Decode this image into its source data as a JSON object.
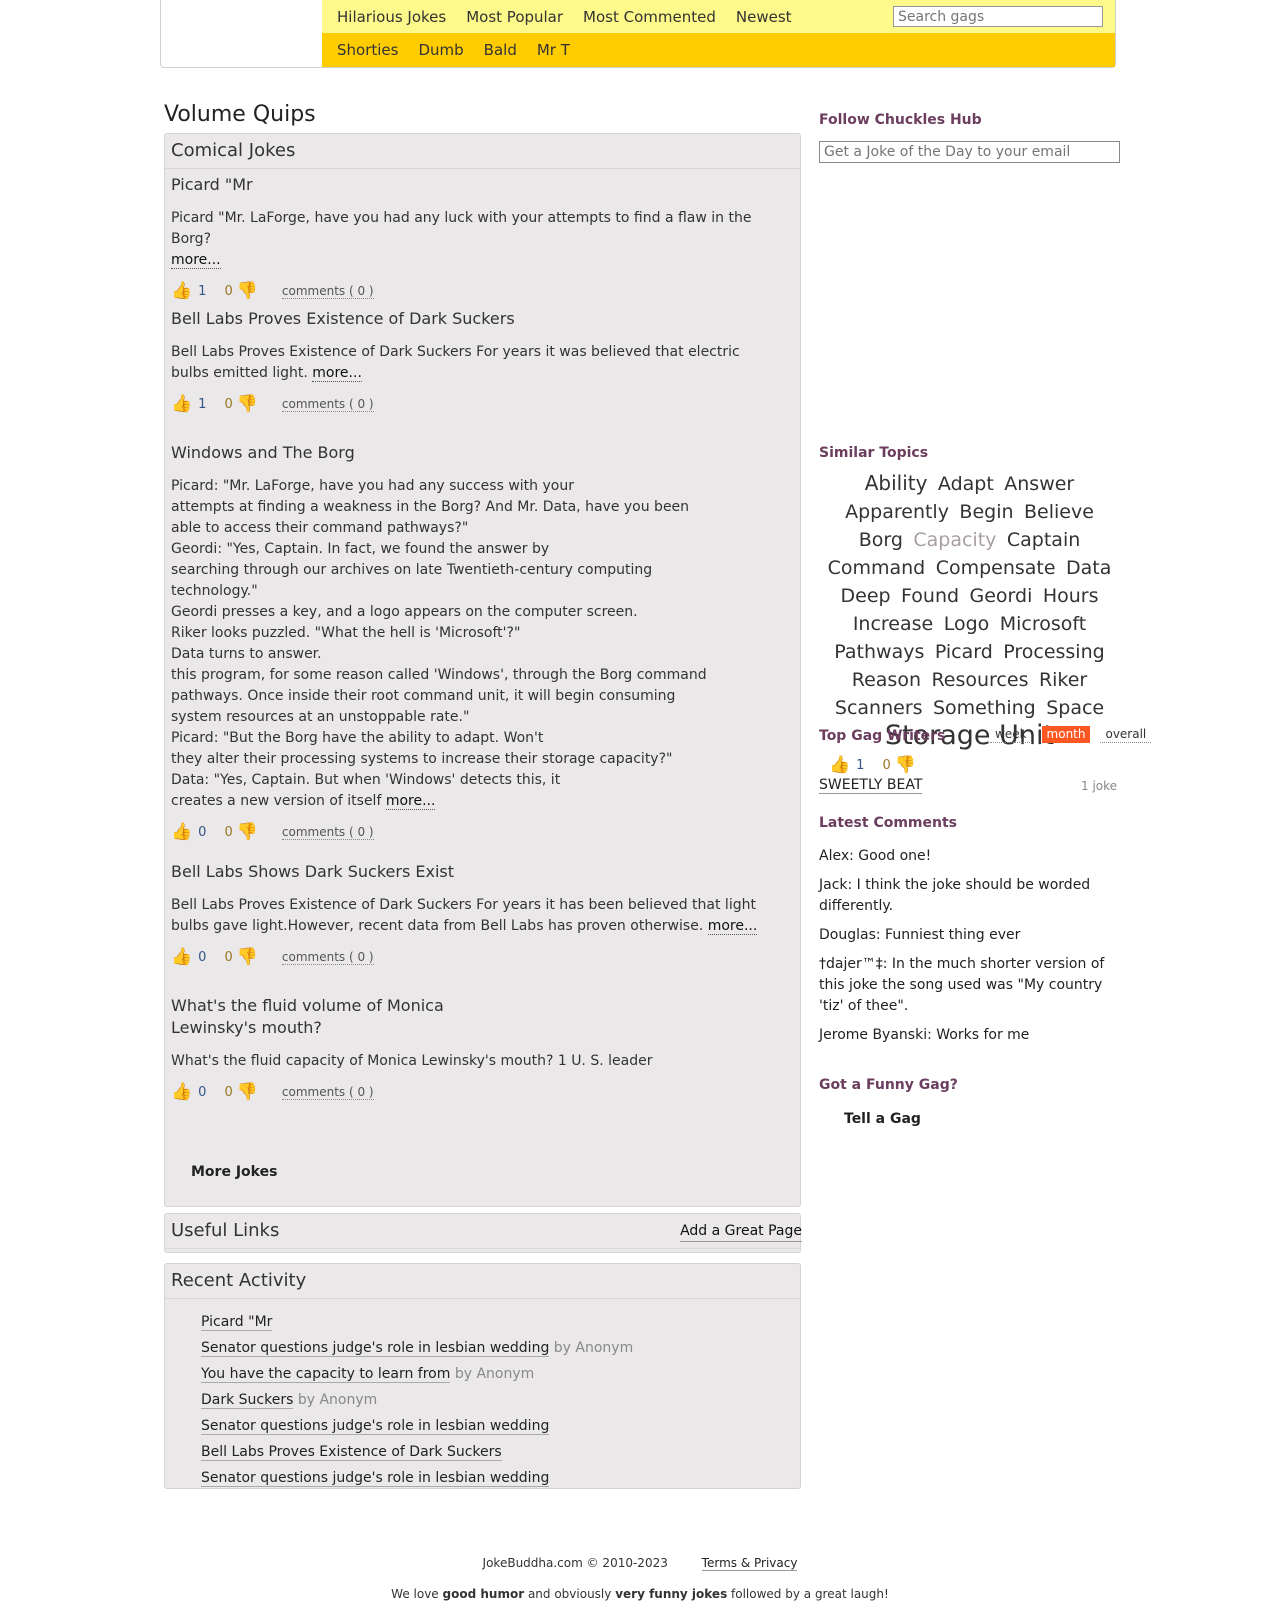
{
  "nav": {
    "top": [
      "Hilarious Jokes",
      "Most Popular",
      "Most Commented",
      "Newest"
    ],
    "bottom": [
      "Shorties",
      "Dumb",
      "Bald",
      "Mr T"
    ],
    "search_placeholder": "Search gags"
  },
  "page_title": "Volume Quips",
  "jokes_section": {
    "heading": "Comical Jokes",
    "more_label": "more...",
    "comments_label": "comments ( 0 )",
    "jokes": [
      {
        "title": "Picard \"Mr",
        "body": "Picard \"Mr. LaForge, have you had any luck with your attempts to find a flaw in the Borg?",
        "up": "1",
        "down": "0"
      },
      {
        "title": "Bell Labs Proves Existence of Dark Suckers",
        "body": "Bell Labs Proves Existence of Dark Suckers For years it was believed that electric bulbs emitted light.",
        "up": "1",
        "down": "0"
      },
      {
        "title": "Windows and The Borg",
        "body": "Picard: \"Mr. LaForge, have you had any success with your\nattempts at finding a weakness in the Borg? And Mr. Data, have you been\nable to access their command pathways?\"\nGeordi: \"Yes, Captain. In fact, we found the answer by\nsearching through our archives on late Twentieth-century computing\ntechnology.\"\nGeordi presses a key, and a logo appears on the computer screen.\nRiker looks puzzled. \"What the hell is 'Microsoft'?\"\nData turns to answer.\nthis program, for some reason called 'Windows', through the Borg command\npathways. Once inside their root command unit, it will begin consuming\nsystem resources at an unstoppable rate.\"\nPicard: \"But the Borg have the ability to adapt. Won't\nthey alter their processing systems to increase their storage capacity?\"\nData: \"Yes, Captain. But when 'Windows' detects this, it\ncreates a new version of itself",
        "up": "0",
        "down": "0"
      },
      {
        "title": "Bell Labs Shows Dark Suckers Exist",
        "body": "Bell Labs Proves Existence of Dark Suckers For years it has been believed that light bulbs gave light.However, recent data from Bell Labs has proven otherwise.",
        "up": "0",
        "down": "0"
      },
      {
        "title": "What's the fluid volume of Monica Lewinsky's mouth?",
        "body": "What's the fluid capacity of Monica Lewinsky's mouth? 1 U. S. leader",
        "up": "0",
        "down": "0"
      }
    ],
    "more_jokes": "More Jokes"
  },
  "useful_links": {
    "heading": "Useful Links",
    "add_label": "Add a Great Page"
  },
  "recent_activity": {
    "heading": "Recent Activity",
    "items": [
      {
        "title": "Picard \"Mr",
        "by": ""
      },
      {
        "title": "Senator questions judge's role in lesbian wedding",
        "by": "by Anonym"
      },
      {
        "title": "You have the capacity to learn from",
        "by": "by Anonym"
      },
      {
        "title": "Dark Suckers",
        "by": "by Anonym"
      },
      {
        "title": "Senator questions judge's role in lesbian wedding",
        "by": ""
      },
      {
        "title": "Bell Labs Proves Existence of Dark Suckers",
        "by": ""
      },
      {
        "title": "Senator questions judge's role in lesbian wedding",
        "by": ""
      }
    ]
  },
  "sidebar": {
    "follow_heading": "Follow Chuckles Hub",
    "email_placeholder": "Get a Joke of the Day to your email",
    "similar_heading": "Similar Topics",
    "tags": [
      "Ability",
      "Adapt",
      "Answer",
      "Apparently",
      "Begin",
      "Believe",
      "Borg",
      "Capacity",
      "Captain",
      "Command",
      "Compensate",
      "Data",
      "Deep",
      "Found",
      "Geordi",
      "Hours",
      "Increase",
      "Logo",
      "Microsoft",
      "Pathways",
      "Picard",
      "Processing",
      "Reason",
      "Resources",
      "Riker",
      "Scanners",
      "Something",
      "Space",
      "Storage Unit"
    ],
    "writers_heading": "Top Gag Writers",
    "periods": [
      "week",
      "month",
      "overall"
    ],
    "active_period": "month",
    "writer": {
      "name": "SWEETLY BEAT",
      "up": "1",
      "down": "0",
      "count": "1 joke"
    },
    "comments_heading": "Latest Comments",
    "comments": [
      "Alex: Good one!",
      "Jack: I think the joke should be worded differently.",
      "Douglas: Funniest thing ever",
      "†dajer™‡: In the much shorter version of this joke the song used was \"My country 'tiz' of thee\".",
      "Jerome Byanski: Works for me"
    ],
    "gag_heading": "Got a Funny Gag?",
    "tell_gag": "Tell a Gag"
  },
  "footer": {
    "copyright": "JokeBuddha.com © 2010-2023",
    "terms": "Terms & Privacy",
    "tagline_pre": "We love ",
    "tagline_b1": "good humor",
    "tagline_mid": " and obviously ",
    "tagline_b2": "very funny jokes",
    "tagline_post": " followed by a great laugh!"
  },
  "colors": {
    "nav_top": "#fdf98a",
    "nav_bottom": "#ffcc00",
    "panel": "#ebe8e9",
    "heading": "#6b3d5e",
    "active_tab": "#ff5722"
  },
  "icons": {
    "up": "thumbs-up-icon",
    "down": "thumbs-down-icon"
  }
}
